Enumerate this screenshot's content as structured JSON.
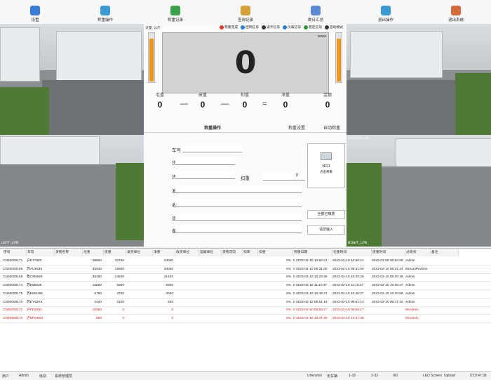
{
  "toolbar": [
    {
      "label": "设置",
      "icon": "settings-icon"
    },
    {
      "label": "称重操作",
      "icon": "weigh-icon"
    },
    {
      "label": "称重记录",
      "icon": "record-book-icon"
    },
    {
      "label": "查询记录",
      "icon": "magic-wand-icon"
    },
    {
      "label": "数日汇总",
      "icon": "summary-icon"
    },
    {
      "label": "退出操作",
      "icon": "home-icon"
    },
    {
      "label": "退出系统",
      "icon": "exit-door-icon"
    }
  ],
  "cameras": {
    "top_left_label": "",
    "bottom_left_label": "LEFT_LPR",
    "top_right_label": "",
    "bottom_right_label": "RIGHT_LPR",
    "bottom_right_date": "2023/02/16"
  },
  "scale": {
    "unit_label": "计量: 公斤",
    "indicators": [
      {
        "label": "称重完成",
        "color": "#e03a2c"
      },
      {
        "label": "控制信号",
        "color": "#2a7fd4"
      },
      {
        "label": "读卡信号",
        "color": "#3a3a3a"
      },
      {
        "label": "仪表信号",
        "color": "#2a7fd4"
      },
      {
        "label": "稳定信号",
        "color": "#2c9a3c"
      },
      {
        "label": "自动模式",
        "color": "#3a3a3a"
      }
    ],
    "display_value": "0",
    "max_label": "30000",
    "gauge_left_level": 0.9,
    "gauge_right_level": 0.9,
    "weights": [
      {
        "label": "毛重",
        "value": "0"
      },
      {
        "label": "皮重",
        "value": "0"
      },
      {
        "label": "扣重",
        "value": "0"
      },
      {
        "label": "净重",
        "value": "0"
      },
      {
        "label": "金额",
        "value": "0"
      }
    ],
    "ops": [
      "—",
      "—",
      "="
    ]
  },
  "tabs": [
    "称重操作",
    "称重设置",
    "自动称重"
  ],
  "form": {
    "fields": [
      {
        "label": "车号",
        "value": ""
      },
      {
        "label": "货物名称",
        "value": ""
      },
      {
        "label": "货物流向",
        "value": ""
      },
      {
        "label": "发货单位",
        "value": ""
      },
      {
        "label": "收货单位",
        "value": ""
      },
      {
        "label": "运输单位",
        "value": ""
      },
      {
        "label": "备注",
        "value": ""
      }
    ],
    "deduct_label": "扣重",
    "deduct_value": "0",
    "device_label": "NO1",
    "device_sub": "点击称重",
    "btn_settle": "全部已缴费",
    "btn_enter": "请您输入"
  },
  "table": {
    "headers": [
      "序号",
      "车号",
      "货物名称",
      "毛重",
      "皮重",
      "发货单位",
      "净重",
      "收货单位",
      "运输单位",
      "货物流向",
      "扣率",
      "扣重",
      "称重日期",
      "毛重时间",
      "皮重时间",
      "过磅员",
      "备注"
    ],
    "rows": [
      {
        "red": false,
        "cells": [
          "CN00000171",
          "沪E77882",
          "",
          "38800",
          "15760",
          "",
          "23040",
          "",
          "",
          "",
          "",
          "0%",
          "0  2023-02-10 10:50:21",
          "2023-02-10 10:50:21",
          "2023-02-09 08:52:05",
          "Admin",
          ""
        ]
      },
      {
        "red": false,
        "cells": [
          "CN00000169",
          "苏AU9435",
          "",
          "35640",
          "15600",
          "",
          "20040",
          "",
          "",
          "",
          "",
          "0%",
          "0  2023-02-10 09:31:00",
          "2023-02-10 09:31:00",
          "2023-02-10 08:31:34",
          "MiAutoPAdmin",
          ""
        ]
      },
      {
        "red": false,
        "cells": [
          "CN00000168",
          "鲁C8N590",
          "",
          "36260",
          "14840",
          "",
          "21420",
          "",
          "",
          "",
          "",
          "0%",
          "0  2023-02-10 10:20:28",
          "2023-02-10 10:20:28",
          "2023-02-10 08:30:18",
          "Admin",
          ""
        ]
      },
      {
        "red": false,
        "cells": [
          "CN00000174",
          "苏E55536",
          "",
          "15600",
          "6300",
          "",
          "9300",
          "",
          "",
          "",
          "",
          "0%",
          "0  2023-02-10 11:10:37",
          "2023-02-10 11:10:37",
          "2023-02-10 10:38:47",
          "Admin",
          ""
        ]
      },
      {
        "red": false,
        "cells": [
          "CN00000175",
          "苏EMS281",
          "",
          "5780",
          "3760",
          "",
          "2020",
          "",
          "",
          "",
          "",
          "0%",
          "0  2023-02-10 10:46:27",
          "2023-02-10 10:46:27",
          "2023-02-10 10:40:58",
          "Admin",
          ""
        ]
      },
      {
        "red": false,
        "cells": [
          "CN00000170",
          "苏EY62K5",
          "",
          "2420",
          "2100",
          "",
          "320",
          "",
          "",
          "",
          "",
          "0%",
          "0  2023-02-10 08:51:14",
          "2023-02-10 08:51:14",
          "2023-02-10 08:47:42",
          "Admin",
          ""
        ]
      },
      {
        "red": true,
        "cells": [
          "CN00000172",
          "沪FD9391",
          "",
          "16380",
          "0",
          "",
          "0",
          "",
          "",
          "",
          "",
          "0%",
          "0  2023-02-10 08:55:17",
          "2023-02-10 08:55:17",
          "",
          "MiAdmin",
          ""
        ]
      },
      {
        "red": true,
        "cells": [
          "CN00000173",
          "沪EPDE53",
          "",
          "680",
          "0",
          "",
          "0",
          "",
          "",
          "",
          "",
          "0%",
          "0  2023-02-10 10:37:49",
          "2023-02-10 10:37:49",
          "",
          "MiAdmin",
          ""
        ]
      }
    ]
  },
  "statusbar": {
    "user_label": "用户",
    "user": "Admin",
    "level_label": "级别",
    "level": "系统管理员",
    "s1": "Unknown",
    "s2": "无车辆",
    "s3": "1-32",
    "s4": "2-32",
    "s5": "0/0",
    "led": "LED Screen",
    "upload": "Upload",
    "time": "0:19:47:38"
  }
}
